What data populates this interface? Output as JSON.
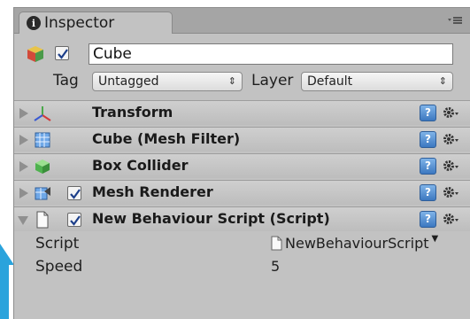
{
  "tab": {
    "label": "Inspector"
  },
  "gameobject": {
    "active": true,
    "name": "Cube",
    "tag_label": "Tag",
    "tag_value": "Untagged",
    "layer_label": "Layer",
    "layer_value": "Default"
  },
  "components": [
    {
      "name": "Transform",
      "icon": "transform-icon"
    },
    {
      "name": "Cube (Mesh Filter)",
      "icon": "mesh-filter-icon"
    },
    {
      "name": "Box Collider",
      "icon": "box-collider-icon"
    },
    {
      "name": "Mesh Renderer",
      "icon": "mesh-renderer-icon",
      "enabled": true
    },
    {
      "name": "New Behaviour Script (Script)",
      "icon": "script-icon",
      "enabled": true,
      "expanded": true
    }
  ],
  "script_props": {
    "script_label": "Script",
    "script_value": "NewBehaviourScript",
    "speed_label": "Speed",
    "speed_value": "5"
  },
  "colors": {
    "panel_bg": "#c2c2c2",
    "help_blue": "#3c78c0",
    "accent_arrow": "#2aa3dc"
  }
}
